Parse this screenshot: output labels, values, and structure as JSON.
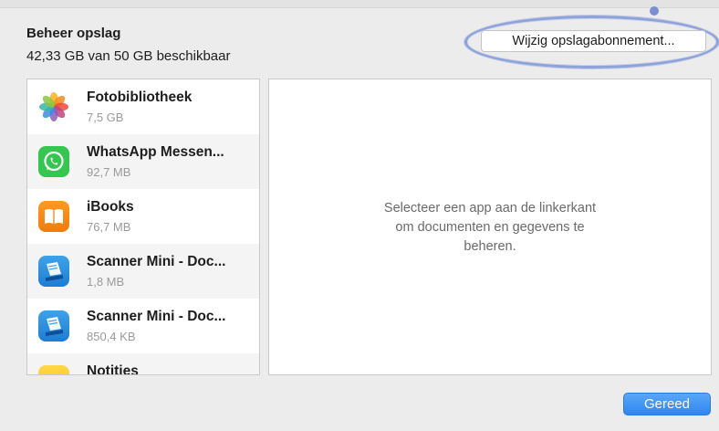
{
  "header": {
    "title": "Beheer opslag",
    "usage": "42,33 GB van 50 GB beschikbaar"
  },
  "toolbar": {
    "change_plan_label": "Wijzig opslagabonnement..."
  },
  "apps": [
    {
      "name": "Fotobibliotheek",
      "size": "7,5 GB",
      "icon": "photos-icon"
    },
    {
      "name": "WhatsApp Messen...",
      "size": "92,7 MB",
      "icon": "whatsapp-icon"
    },
    {
      "name": "iBooks",
      "size": "76,7 MB",
      "icon": "books-icon"
    },
    {
      "name": "Scanner Mini - Doc...",
      "size": "1,8 MB",
      "icon": "scanner-icon"
    },
    {
      "name": "Scanner Mini - Doc...",
      "size": "850,4 KB",
      "icon": "scanner-icon"
    },
    {
      "name": "Notities",
      "size": "",
      "icon": "notes-icon"
    }
  ],
  "detail": {
    "line1": "Selecteer een app aan de linkerkant",
    "line2": "om documenten en gegevens te",
    "line3": "beheren."
  },
  "footer": {
    "done_label": "Gereed"
  },
  "colors": {
    "accent": "#2e86f2",
    "highlight_ring": "#8ea2dc",
    "whatsapp": "#35c64f",
    "books": "#f07c0a",
    "scanner": "#1c7dd4",
    "notes": "#f6c400"
  }
}
